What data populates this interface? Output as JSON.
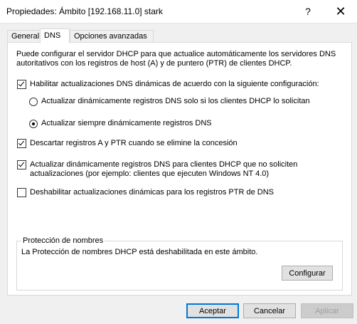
{
  "window": {
    "title": "Propiedades: Ámbito [192.168.11.0] stark",
    "help_label": "?",
    "close_label": "✕"
  },
  "tabs": [
    {
      "label": "General"
    },
    {
      "label": "DNS"
    },
    {
      "label": "Opciones avanzadas"
    }
  ],
  "dns": {
    "description": "Puede configurar el servidor DHCP para que actualice automáticamente los servidores DNS autoritativos con los registros de host (A) y de puntero (PTR) de clientes DHCP.",
    "enable_updates": {
      "label": "Habilitar actualizaciones DNS dinámicas de acuerdo con la  siguiente configuración:",
      "checked": true
    },
    "radio_on_request": {
      "label": "Actualizar dinámicamente registros DNS solo si los clientes DHCP lo solicitan",
      "selected": false
    },
    "radio_always": {
      "label": "Actualizar siempre dinámicamente registros DNS",
      "selected": true
    },
    "discard_on_delete": {
      "label": "Descartar registros A y PTR cuando se elimine la concesión",
      "checked": true
    },
    "update_for_non_requesting": {
      "label": "Actualizar dinámicamente registros DNS para clientes DHCP que no soliciten actualizaciones (por ejemplo: clientes que ejecuten Windows NT 4.0)",
      "checked": true
    },
    "disable_ptr": {
      "label": "Deshabilitar actualizaciones dinámicas para los registros PTR de DNS",
      "checked": false
    }
  },
  "name_protection": {
    "title": "Protección de nombres",
    "status": "La Protección de nombres DHCP está deshabilitada en este ámbito.",
    "configure_label": "Configurar"
  },
  "footer": {
    "ok_label": "Aceptar",
    "cancel_label": "Cancelar",
    "apply_label": "Aplicar"
  }
}
